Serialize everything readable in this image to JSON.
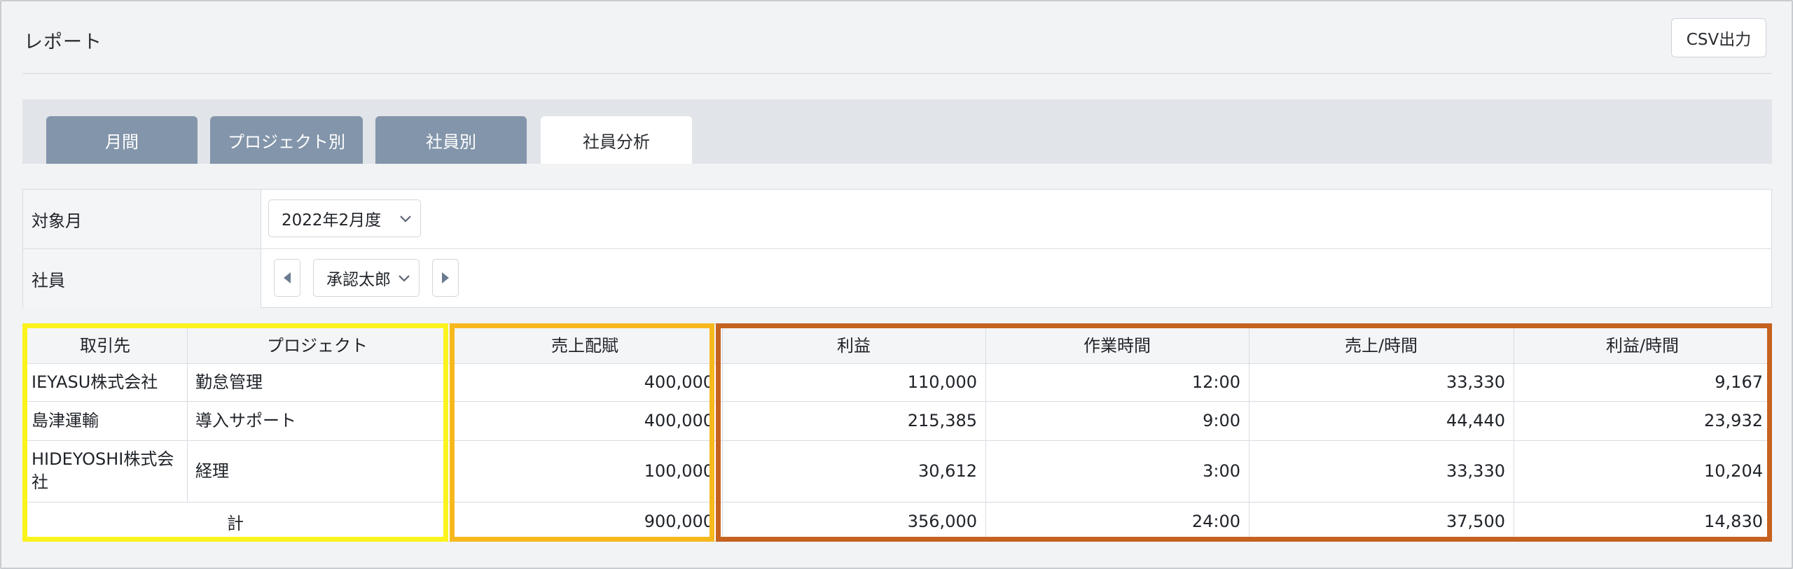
{
  "header": {
    "title": "レポート",
    "csv_button": "CSV出力"
  },
  "tabs": [
    {
      "label": "月間",
      "active": false
    },
    {
      "label": "プロジェクト別",
      "active": false
    },
    {
      "label": "社員別",
      "active": false
    },
    {
      "label": "社員分析",
      "active": true
    }
  ],
  "filters": {
    "month_label": "対象月",
    "month_value": "2022年2月度",
    "employee_label": "社員",
    "employee_value": "承認太郎"
  },
  "table": {
    "columns": [
      "取引先",
      "プロジェクト",
      "売上配賦",
      "利益",
      "作業時間",
      "売上/時間",
      "利益/時間"
    ],
    "rows": [
      {
        "client": "IEYASU株式会社",
        "project": "勤怠管理",
        "sales": "400,000",
        "profit": "110,000",
        "hours": "12:00",
        "sales_per_hour": "33,330",
        "profit_per_hour": "9,167"
      },
      {
        "client": "島津運輸",
        "project": "導入サポート",
        "sales": "400,000",
        "profit": "215,385",
        "hours": "9:00",
        "sales_per_hour": "44,440",
        "profit_per_hour": "23,932"
      },
      {
        "client": "HIDEYOSHI株式会社",
        "project": "経理",
        "sales": "100,000",
        "profit": "30,612",
        "hours": "3:00",
        "sales_per_hour": "33,330",
        "profit_per_hour": "10,204"
      }
    ],
    "total": {
      "label": "計",
      "sales": "900,000",
      "profit": "356,000",
      "hours": "24:00",
      "sales_per_hour": "37,500",
      "profit_per_hour": "14,830"
    }
  },
  "icons": {
    "month_select": "chevron-down-icon",
    "employee_select": "chevron-down-icon",
    "prev": "triangle-left-icon",
    "next": "triangle-right-icon"
  },
  "colors": {
    "tab_inactive": "#8395aa",
    "highlight_yellow": "#fbf31d",
    "highlight_orange": "#f6b81d",
    "highlight_rust": "#c5621f"
  }
}
